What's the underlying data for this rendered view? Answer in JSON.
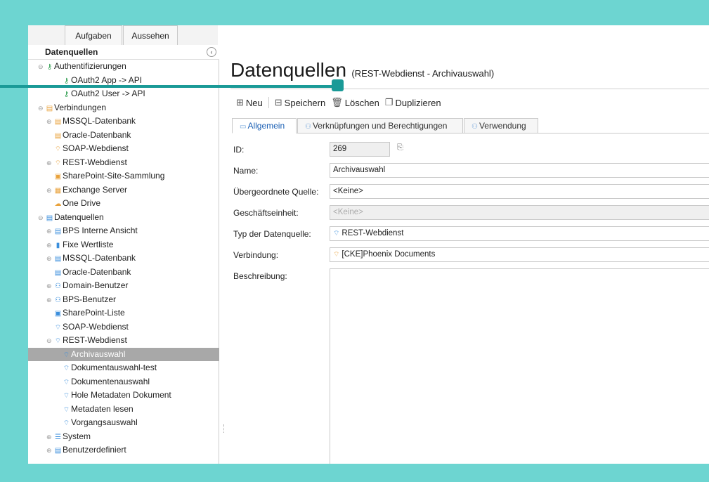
{
  "ribbon": {
    "tabs": [
      "Aufgaben",
      "Aussehen"
    ]
  },
  "sidebar": {
    "title": "Datenquellen",
    "tree": [
      {
        "label": "Authentifizierungen",
        "level": 0,
        "icon": "key-icon",
        "glyph": "⚷",
        "color": "green",
        "exp": "⊖"
      },
      {
        "label": "OAuth2 App -> API",
        "level": 2,
        "icon": "key-icon",
        "glyph": "⚷",
        "color": "green",
        "exp": ""
      },
      {
        "label": "OAuth2 User -> API",
        "level": 2,
        "icon": "key-icon",
        "glyph": "⚷",
        "color": "green",
        "exp": ""
      },
      {
        "label": "Verbindungen",
        "level": 0,
        "icon": "connection-icon",
        "glyph": "▤",
        "color": "orange",
        "exp": "⊖"
      },
      {
        "label": "MSSQL-Datenbank",
        "level": 1,
        "icon": "database-icon",
        "glyph": "▤",
        "color": "orange",
        "exp": "⊕"
      },
      {
        "label": "Oracle-Datenbank",
        "level": 1,
        "icon": "database-icon",
        "glyph": "▤",
        "color": "orange",
        "exp": ""
      },
      {
        "label": "SOAP-Webdienst",
        "level": 1,
        "icon": "webservice-icon",
        "glyph": "⌔",
        "color": "orange",
        "exp": ""
      },
      {
        "label": "REST-Webdienst",
        "level": 1,
        "icon": "webservice-icon",
        "glyph": "⌔",
        "color": "orange",
        "exp": "⊕"
      },
      {
        "label": "SharePoint-Site-Sammlung",
        "level": 1,
        "icon": "sharepoint-icon",
        "glyph": "▣",
        "color": "orange",
        "exp": ""
      },
      {
        "label": "Exchange Server",
        "level": 1,
        "icon": "exchange-icon",
        "glyph": "▦",
        "color": "orange",
        "exp": "⊕"
      },
      {
        "label": "One Drive",
        "level": 1,
        "icon": "cloud-icon",
        "glyph": "☁",
        "color": "orange",
        "exp": ""
      },
      {
        "label": "Datenquellen",
        "level": 0,
        "icon": "database-icon",
        "glyph": "▤",
        "color": "blue",
        "exp": "⊖"
      },
      {
        "label": "BPS Interne Ansicht",
        "level": 1,
        "icon": "view-icon",
        "glyph": "▤",
        "color": "blue",
        "exp": "⊕"
      },
      {
        "label": "Fixe Wertliste",
        "level": 1,
        "icon": "list-icon",
        "glyph": "▮",
        "color": "blue",
        "exp": "⊕"
      },
      {
        "label": "MSSQL-Datenbank",
        "level": 1,
        "icon": "database-icon",
        "glyph": "▤",
        "color": "blue",
        "exp": "⊕"
      },
      {
        "label": "Oracle-Datenbank",
        "level": 1,
        "icon": "database-icon",
        "glyph": "▤",
        "color": "blue",
        "exp": ""
      },
      {
        "label": "Domain-Benutzer",
        "level": 1,
        "icon": "users-icon",
        "glyph": "⚇",
        "color": "blue",
        "exp": "⊕"
      },
      {
        "label": "BPS-Benutzer",
        "level": 1,
        "icon": "users-icon",
        "glyph": "⚇",
        "color": "blue",
        "exp": "⊕"
      },
      {
        "label": "SharePoint-Liste",
        "level": 1,
        "icon": "sharepoint-icon",
        "glyph": "▣",
        "color": "blue",
        "exp": ""
      },
      {
        "label": "SOAP-Webdienst",
        "level": 1,
        "icon": "webservice-icon",
        "glyph": "⌔",
        "color": "blue",
        "exp": ""
      },
      {
        "label": "REST-Webdienst",
        "level": 1,
        "icon": "webservice-icon",
        "glyph": "⌔",
        "color": "blue",
        "exp": "⊖"
      },
      {
        "label": "Archivauswahl",
        "level": 2,
        "icon": "webservice-icon",
        "glyph": "⌔",
        "color": "blue",
        "exp": "",
        "selected": true
      },
      {
        "label": "Dokumentauswahl-test",
        "level": 2,
        "icon": "webservice-icon",
        "glyph": "⌔",
        "color": "blue",
        "exp": ""
      },
      {
        "label": "Dokumentenauswahl",
        "level": 2,
        "icon": "webservice-icon",
        "glyph": "⌔",
        "color": "blue",
        "exp": ""
      },
      {
        "label": "Hole Metadaten Dokument",
        "level": 2,
        "icon": "webservice-icon",
        "glyph": "⌔",
        "color": "blue",
        "exp": ""
      },
      {
        "label": "Metadaten lesen",
        "level": 2,
        "icon": "webservice-icon",
        "glyph": "⌔",
        "color": "blue",
        "exp": ""
      },
      {
        "label": "Vorgangsauswahl",
        "level": 2,
        "icon": "webservice-icon",
        "glyph": "⌔",
        "color": "blue",
        "exp": ""
      },
      {
        "label": "System",
        "level": 1,
        "icon": "system-icon",
        "glyph": "☰",
        "color": "blue",
        "exp": "⊕"
      },
      {
        "label": "Benutzerdefiniert",
        "level": 1,
        "icon": "database-icon",
        "glyph": "▤",
        "color": "blue",
        "exp": "⊕"
      }
    ]
  },
  "main": {
    "title": "Datenquellen",
    "subtitle": "(REST-Webdienst - Archivauswahl)",
    "toolbar": {
      "new": "Neu",
      "save": "Speichern",
      "delete": "Löschen",
      "duplicate": "Duplizieren"
    },
    "tabs": [
      "Allgemein",
      "Verknüpfungen und Berechtigungen",
      "Verwendung"
    ],
    "form": {
      "id_label": "ID:",
      "id_value": "269",
      "name_label": "Name:",
      "name_value": "Archivauswahl",
      "parent_label": "Übergeordnete Quelle:",
      "parent_value": "<Keine>",
      "unit_label": "Geschäftseinheit:",
      "unit_value": "<Keine>",
      "type_label": "Typ der Datenquelle:",
      "type_value": "REST-Webdienst",
      "conn_label": "Verbindung:",
      "conn_value": "[CKE]Phoenix Documents",
      "desc_label": "Beschreibung:"
    }
  },
  "colors": {
    "background": "#6dd5d1",
    "accent_line": "#1a9a97",
    "selection": "#a8a8a8"
  }
}
